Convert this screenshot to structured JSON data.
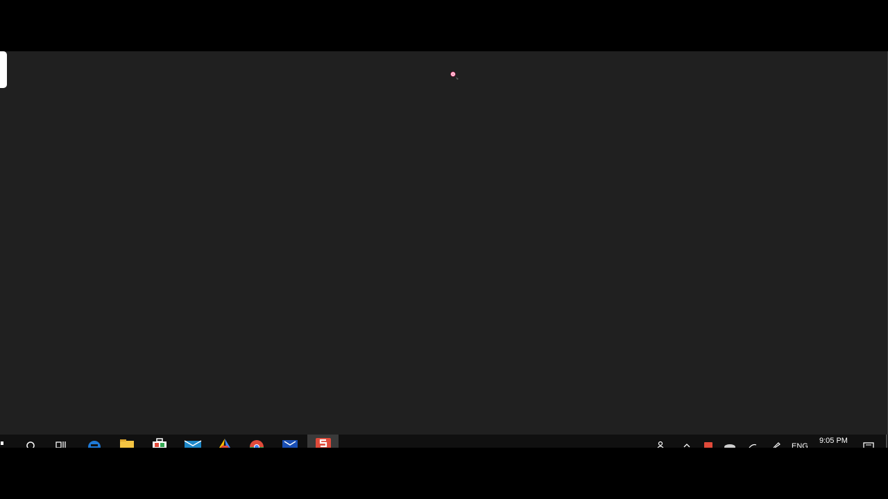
{
  "taskbar": {
    "apps": [
      {
        "name": "start",
        "icon": "windows-start-icon"
      },
      {
        "name": "search",
        "icon": "search-icon"
      },
      {
        "name": "task-view",
        "icon": "task-view-icon"
      },
      {
        "name": "edge",
        "icon": "edge-browser-icon"
      },
      {
        "name": "file-explorer",
        "icon": "folder-icon"
      },
      {
        "name": "store",
        "icon": "store-bag-icon"
      },
      {
        "name": "mail",
        "icon": "mail-icon"
      },
      {
        "name": "drive",
        "icon": "drive-icon"
      },
      {
        "name": "chrome",
        "icon": "chrome-icon"
      },
      {
        "name": "app-blue",
        "icon": "blue-app-icon"
      },
      {
        "name": "screen-recorder",
        "icon": "red-s-app-icon",
        "active": true
      }
    ],
    "tray": {
      "language": "ENG",
      "time": "9:05 PM"
    }
  },
  "colors": {
    "desktop_bg": "#202020",
    "taskbar_bg": "#101010",
    "frame_bg": "#000000",
    "accent_red": "#e04a3a"
  }
}
